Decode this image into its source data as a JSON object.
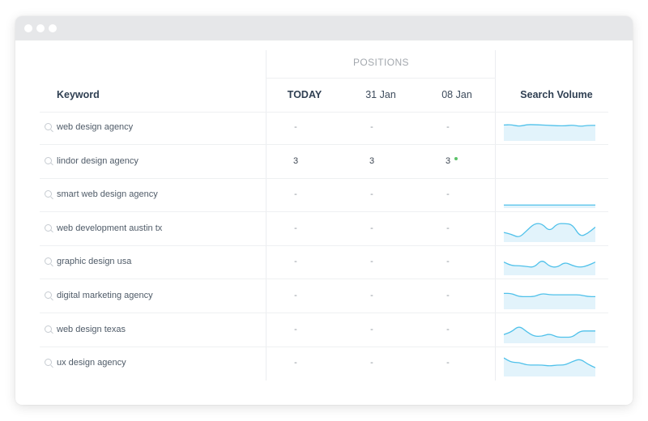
{
  "table": {
    "positions_label": "POSITIONS",
    "headers": {
      "keyword": "Keyword",
      "today": "TODAY",
      "date1": "31 Jan",
      "date2": "08 Jan",
      "volume": "Search Volume"
    },
    "rows": [
      {
        "keyword": "web design agency",
        "today": "-",
        "date1": "-",
        "date2": "-",
        "trend": [
          0.8,
          0.82,
          0.72,
          0.82,
          0.82,
          0.8,
          0.78,
          0.76,
          0.75,
          0.8,
          0.72,
          0.78,
          0.78
        ]
      },
      {
        "keyword": "lindor design agency",
        "today": "3",
        "date1": "3",
        "date2": "3",
        "trend": null
      },
      {
        "keyword": "smart web design agency",
        "today": "-",
        "date1": "-",
        "date2": "-",
        "trend": [
          0.08,
          0.08,
          0.08,
          0.08,
          0.08,
          0.08,
          0.08,
          0.08,
          0.08,
          0.08,
          0.08,
          0.08,
          0.08
        ]
      },
      {
        "keyword": "web development austin tx",
        "today": "-",
        "date1": "-",
        "date2": "-",
        "trend": [
          0.45,
          0.35,
          0.15,
          0.55,
          0.95,
          0.95,
          0.5,
          0.95,
          0.95,
          0.9,
          0.2,
          0.4,
          0.75
        ]
      },
      {
        "keyword": "graphic design usa",
        "today": "-",
        "date1": "-",
        "date2": "-",
        "trend": [
          0.65,
          0.45,
          0.45,
          0.4,
          0.35,
          0.8,
          0.4,
          0.35,
          0.65,
          0.45,
          0.35,
          0.45,
          0.65
        ]
      },
      {
        "keyword": "digital marketing agency",
        "today": "-",
        "date1": "-",
        "date2": "-",
        "trend": [
          0.8,
          0.8,
          0.62,
          0.62,
          0.62,
          0.8,
          0.72,
          0.72,
          0.72,
          0.72,
          0.72,
          0.62,
          0.62
        ]
      },
      {
        "keyword": "web design texas",
        "today": "-",
        "date1": "-",
        "date2": "-",
        "trend": [
          0.4,
          0.55,
          0.9,
          0.55,
          0.3,
          0.3,
          0.45,
          0.25,
          0.25,
          0.25,
          0.6,
          0.6,
          0.6
        ]
      },
      {
        "keyword": "ux design agency",
        "today": "-",
        "date1": "-",
        "date2": "-",
        "trend": [
          0.95,
          0.7,
          0.7,
          0.55,
          0.55,
          0.55,
          0.5,
          0.55,
          0.55,
          0.75,
          0.9,
          0.6,
          0.4
        ]
      }
    ]
  },
  "colors": {
    "spark_stroke": "#4fc1ea",
    "spark_fill": "#e2f3fb",
    "up_indicator": "#5cc36a"
  }
}
